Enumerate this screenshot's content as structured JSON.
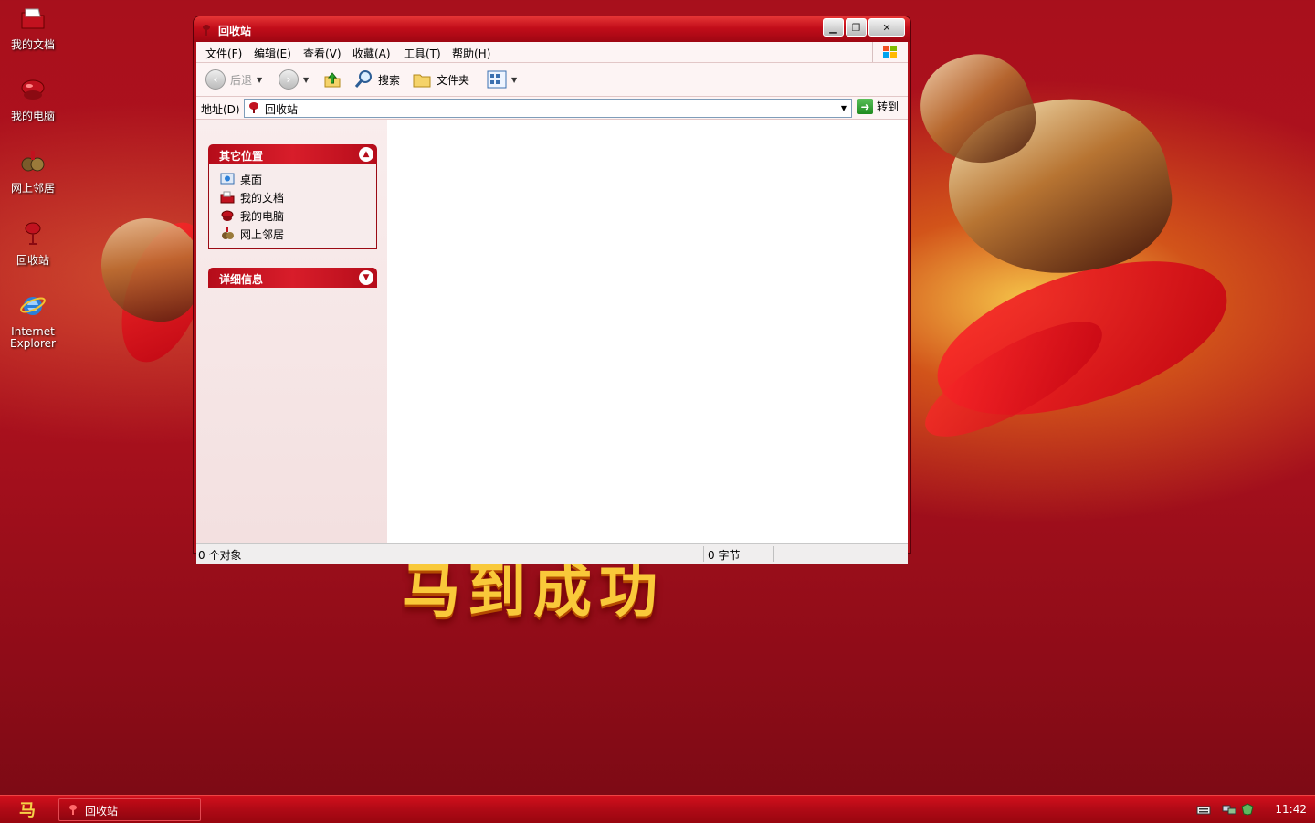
{
  "desktop": {
    "icons": [
      {
        "label": "我的文档",
        "icon": "my-documents-icon"
      },
      {
        "label": "我的电脑",
        "icon": "my-computer-icon"
      },
      {
        "label": "网上邻居",
        "icon": "network-places-icon"
      },
      {
        "label": "回收站",
        "icon": "recycle-bin-icon"
      },
      {
        "label": "Internet Explorer",
        "icon": "internet-explorer-icon"
      }
    ]
  },
  "window": {
    "title": "回收站",
    "menu": [
      {
        "label": "文件(F)"
      },
      {
        "label": "编辑(E)"
      },
      {
        "label": "查看(V)"
      },
      {
        "label": "收藏(A)"
      },
      {
        "label": "工具(T)"
      },
      {
        "label": "帮助(H)"
      }
    ],
    "toolbar": {
      "back_label": "后退",
      "search_label": "搜索",
      "folders_label": "文件夹"
    },
    "address": {
      "label": "地址(D)",
      "value": "回收站",
      "go_label": "转到"
    },
    "taskpane": {
      "other_places_title": "其它位置",
      "other_places": [
        {
          "label": "桌面",
          "icon": "desktop-icon"
        },
        {
          "label": "我的文档",
          "icon": "my-documents-icon"
        },
        {
          "label": "我的电脑",
          "icon": "my-computer-icon"
        },
        {
          "label": "网上邻居",
          "icon": "network-places-icon"
        }
      ],
      "details_title": "详细信息"
    },
    "status": {
      "objects": "0 个对象",
      "size": "0 字节"
    }
  },
  "taskbar": {
    "start_glyph": "马",
    "items": [
      {
        "label": "回收站",
        "icon": "recycle-bin-icon"
      }
    ],
    "clock": "11:42"
  },
  "colors": {
    "accent": "#c20d1a",
    "pane_header": "#b50c1a",
    "desktop_bg": "#a8101c"
  }
}
